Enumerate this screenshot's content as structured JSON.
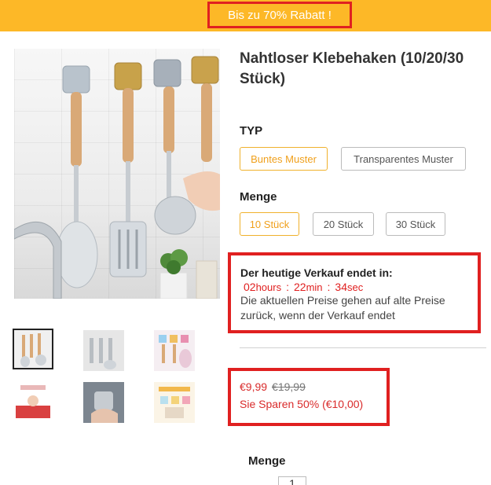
{
  "promo": {
    "text": "Bis zu 70% Rabatt !"
  },
  "product": {
    "title": "Nahtloser Klebehaken (10/20/30 Stück)"
  },
  "options": {
    "type": {
      "heading": "TYP",
      "choices": [
        "Buntes Muster",
        "Transparentes Muster"
      ],
      "selected": "Buntes Muster"
    },
    "quantity": {
      "heading": "Menge",
      "choices": [
        "10 Stück",
        "20 Stück",
        "30 Stück"
      ],
      "selected": "10 Stück"
    }
  },
  "sale": {
    "heading": "Der heutige Verkauf endet in:",
    "hours": "02",
    "hours_unit": "hours",
    "minutes": "22",
    "minutes_unit": "min",
    "seconds": "34",
    "seconds_unit": "sec",
    "separator": ":",
    "note": "Die aktuellen Preise gehen auf alte Preise zurück, wenn der Verkauf endet"
  },
  "price": {
    "current": "€9,99",
    "old": "€19,99",
    "savings": "Sie Sparen 50% (€10,00)"
  },
  "qty_section": {
    "label": "Menge",
    "value": "1"
  },
  "colors": {
    "accent": "#fdb827",
    "highlight": "#e02020",
    "price": "#d92b2b",
    "selected_chip": "#f0b12c"
  }
}
